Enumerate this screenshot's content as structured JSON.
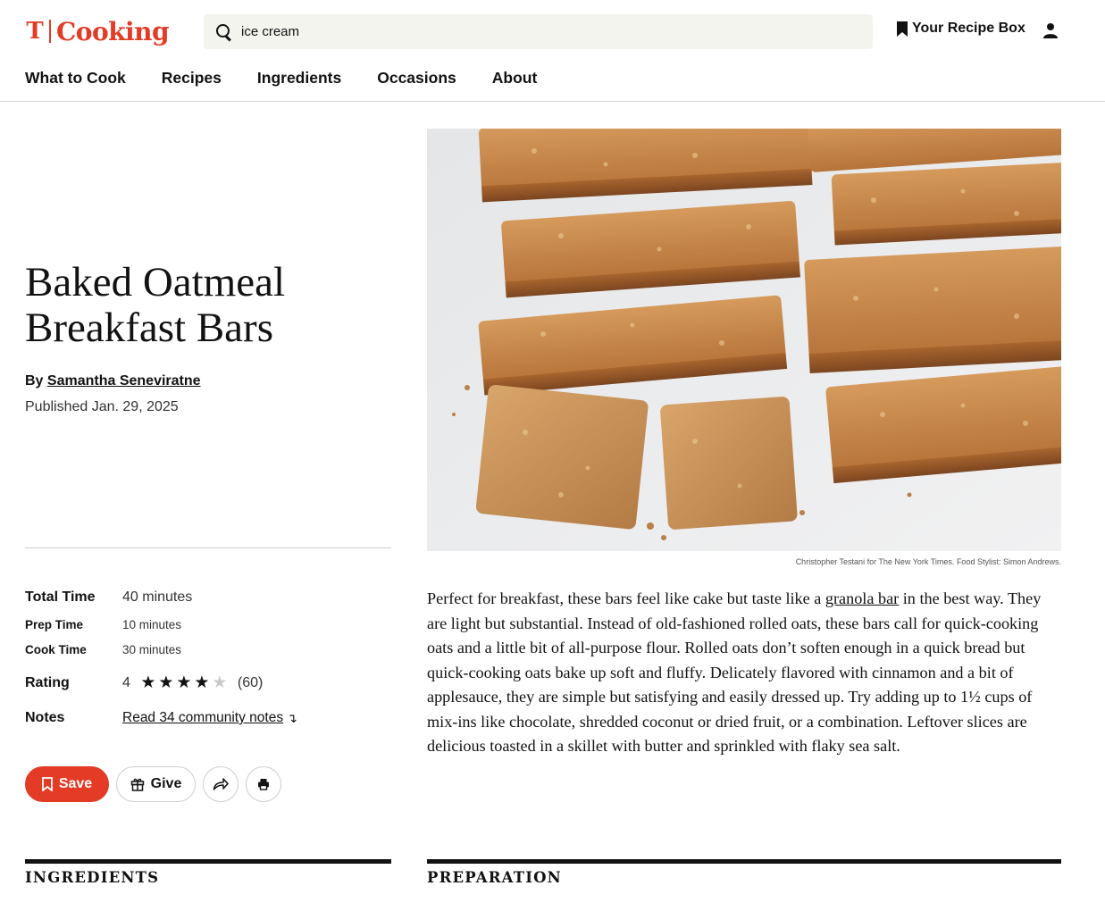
{
  "brand": {
    "logo_glyph": "T",
    "wordmark": "Cooking",
    "color": "#e33b26"
  },
  "search": {
    "value": "ice cream",
    "placeholder": ""
  },
  "header": {
    "recipe_box_label": "Your Recipe Box"
  },
  "nav": [
    {
      "label": "What to Cook"
    },
    {
      "label": "Recipes"
    },
    {
      "label": "Ingredients"
    },
    {
      "label": "Occasions"
    },
    {
      "label": "About"
    }
  ],
  "recipe": {
    "title": "Baked Oatmeal Breakfast Bars",
    "by_prefix": "By",
    "author": "Samantha Seneviratne",
    "published": "Published Jan. 29, 2025",
    "total_time_label": "Total Time",
    "total_time": "40 minutes",
    "prep_time_label": "Prep Time",
    "prep_time": "10 minutes",
    "cook_time_label": "Cook Time",
    "cook_time": "30 minutes",
    "rating_label": "Rating",
    "rating_value": "4",
    "rating_stars": 4,
    "rating_max": 5,
    "rating_count": "(60)",
    "notes_label": "Notes",
    "notes_link": "Read 34 community notes",
    "image_caption": "Christopher Testani for The New York Times. Food Stylist: Simon Andrews.",
    "description_before_link": "Perfect for breakfast, these bars feel like cake but taste like a ",
    "description_link": "granola bar",
    "description_after_link": " in the best way. They are light but substantial. Instead of old-fashioned rolled oats, these bars call for quick-cooking oats and a little bit of all-purpose flour. Rolled oats don’t soften enough in a quick bread but quick-cooking oats bake up soft and fluffy. Delicately flavored with cinnamon and a bit of applesauce, they are simple but satisfying and easily dressed up. Try adding up to 1½ cups of mix-ins like chocolate, shredded coconut or dried fruit, or a combination. Leftover slices are delicious toasted in a skillet with butter and sprinkled with flaky sea salt."
  },
  "actions": {
    "save_label": "Save",
    "give_label": "Give"
  },
  "sections": {
    "ingredients": "INGREDIENTS",
    "preparation": "PREPARATION"
  },
  "colors": {
    "accent": "#e33b26",
    "search_bg": "#f3f4ee",
    "text": "#121212"
  }
}
